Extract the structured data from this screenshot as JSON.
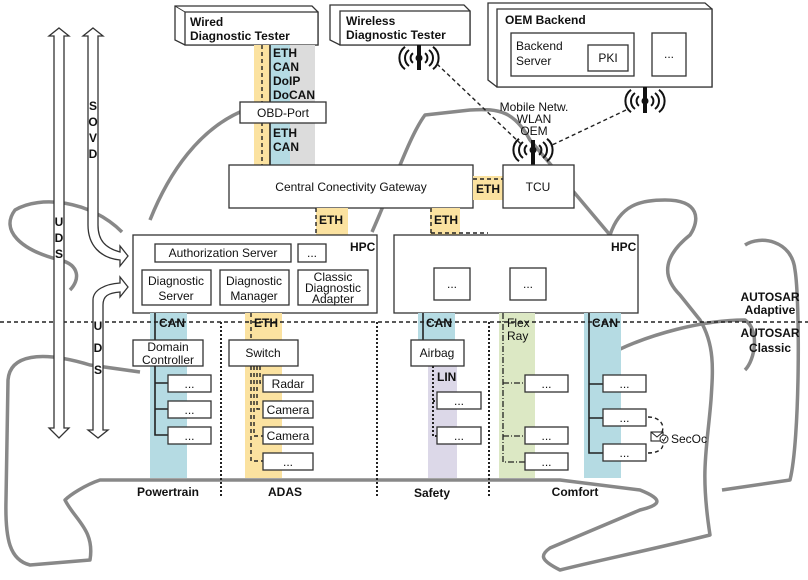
{
  "colors": {
    "eth": "#fbe2a0",
    "can": "#b5dbe3",
    "lin": "#dcd8e8",
    "flexray": "#dce8c4",
    "gray_bus": "#dcdcdc",
    "car_outline": "#888888"
  },
  "testers": {
    "wired": [
      "Wired",
      "Diagnostic Tester"
    ],
    "wireless": [
      "Wireless",
      "Diagnostic Tester"
    ]
  },
  "obd_bus_labels": [
    "ETH",
    "CAN",
    "DoIP",
    "DoCAN"
  ],
  "obd_port": "OBD-Port",
  "obd_lower_labels": [
    "ETH",
    "CAN"
  ],
  "oem_backend": {
    "title": "OEM Backend",
    "backend_server": [
      "Backend",
      "Server"
    ],
    "pki": "PKI",
    "more": "..."
  },
  "wireless_labels": [
    "Mobile Netw.",
    "WLAN",
    "OEM"
  ],
  "gateway": "Central Conectivity Gateway",
  "tcu": "TCU",
  "eth": "ETH",
  "hpc_left": {
    "label": "HPC",
    "auth_server": "Authorization Server",
    "more": "...",
    "diag_server": [
      "Diagnostic",
      "Server"
    ],
    "diag_manager": [
      "Diagnostic",
      "Manager"
    ],
    "classic_adapter": [
      "Classic",
      "Diagnostic",
      "Adapter"
    ]
  },
  "hpc_right": {
    "label": "HPC",
    "more": "..."
  },
  "autosar": {
    "adaptive": [
      "AUTOSAR",
      "Adaptive"
    ],
    "classic": [
      "AUTOSAR",
      "Classic"
    ]
  },
  "arrows": {
    "sovd": [
      "S",
      "O",
      "V",
      "D"
    ],
    "uds": [
      "U",
      "D",
      "S"
    ]
  },
  "domains": {
    "powertrain": {
      "label": "Powertrain",
      "bus": "CAN",
      "controller": [
        "Domain",
        "Controller"
      ],
      "ecus": [
        "...",
        "...",
        "..."
      ]
    },
    "adas": {
      "label": "ADAS",
      "bus": "ETH",
      "switch": "Switch",
      "ecus": [
        "Radar",
        "Camera",
        "Camera",
        "..."
      ]
    },
    "safety": {
      "label": "Safety",
      "bus": "CAN",
      "airbag": "Airbag",
      "sub_bus": "LIN",
      "ecus": [
        "...",
        "..."
      ]
    },
    "comfort": {
      "label": "Comfort",
      "flexray": [
        "Flex",
        "Ray"
      ],
      "flexray_ecus": [
        "...",
        "...",
        "..."
      ],
      "bus": "CAN",
      "can_ecus": [
        "...",
        "...",
        "..."
      ],
      "secoc": "SecOc"
    }
  }
}
